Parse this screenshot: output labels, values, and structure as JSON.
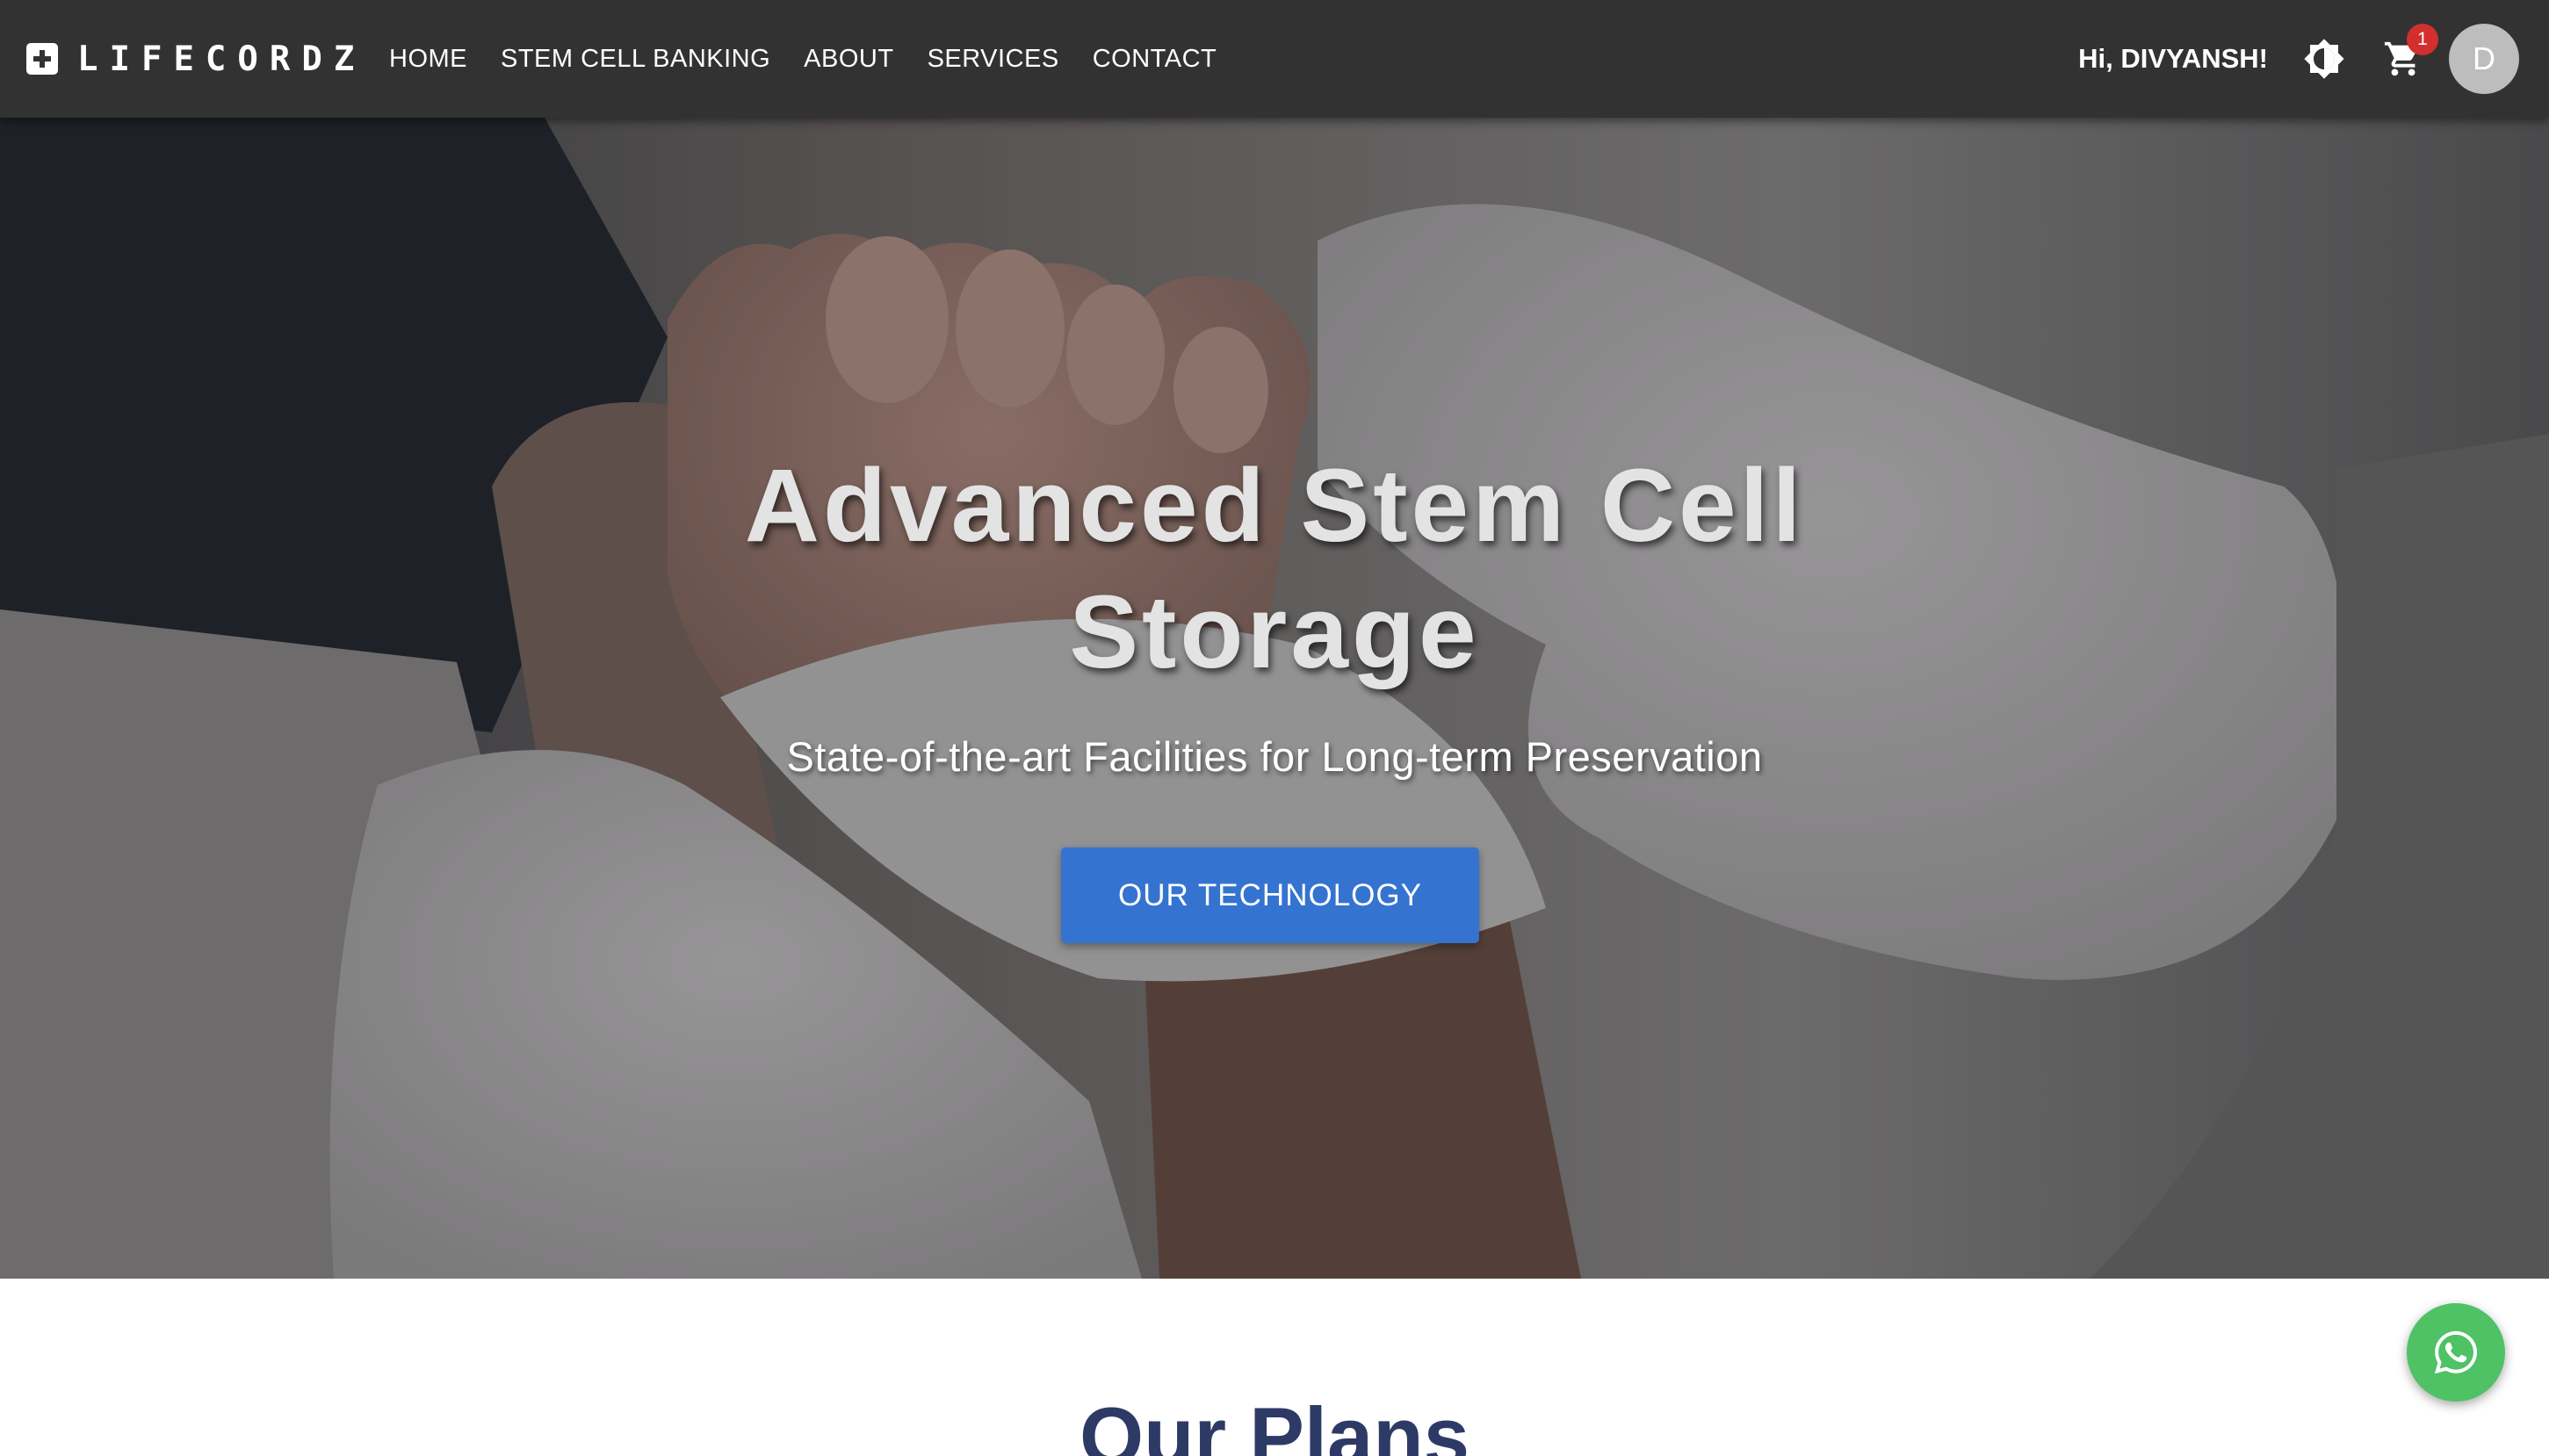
{
  "navbar": {
    "brand": "LIFECORDZ",
    "links": [
      "HOME",
      "STEM CELL BANKING",
      "ABOUT",
      "SERVICES",
      "CONTACT"
    ],
    "greeting": "Hi, DIVYANSH!",
    "cart_count": "1",
    "avatar_initial": "D",
    "icons": [
      "brand-cross-icon",
      "brightness-icon",
      "cart-icon"
    ]
  },
  "hero": {
    "title_line1": "Advanced Stem Cell",
    "title_line2": "Storage",
    "subtitle": "State-of-the-art Facilities for Long-term Preservation",
    "cta_label": "OUR TECHNOLOGY"
  },
  "plans": {
    "heading": "Our Plans"
  },
  "floating": {
    "icon": "whatsapp-icon"
  },
  "colors": {
    "navbar_bg": "#323232",
    "cta_bg": "#3573d0",
    "badge_bg": "#d32f2f",
    "heading_text": "#2e3a66",
    "whatsapp_bg": "#4ec264",
    "avatar_bg": "#bdbdbd"
  }
}
